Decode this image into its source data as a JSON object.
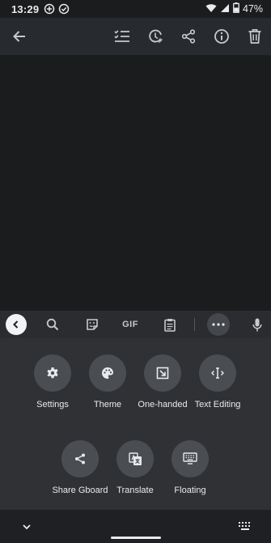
{
  "status_bar": {
    "time": "13:29",
    "battery_percent": "47%",
    "icons": [
      "add-circle-icon",
      "check-circle-icon",
      "wifi-icon",
      "signal-icon",
      "battery-icon"
    ]
  },
  "app_bar": {
    "icons": [
      "back-arrow-icon",
      "checklist-icon",
      "reminder-icon",
      "share-icon",
      "info-icon",
      "delete-icon"
    ]
  },
  "keyboard_toolbar": {
    "gif_label": "GIF",
    "icons": [
      "collapse-icon",
      "search-icon",
      "sticker-icon",
      "gif-icon",
      "clipboard-icon",
      "more-icon",
      "mic-icon"
    ]
  },
  "keyboard_options": [
    {
      "label": "Settings",
      "icon": "gear-icon"
    },
    {
      "label": "Theme",
      "icon": "palette-icon"
    },
    {
      "label": "One-handed",
      "icon": "one-handed-icon"
    },
    {
      "label": "Text Editing",
      "icon": "text-cursor-icon"
    },
    {
      "label": "Share Gboard",
      "icon": "share-icon"
    },
    {
      "label": "Translate",
      "icon": "translate-icon"
    },
    {
      "label": "Floating",
      "icon": "keyboard-icon"
    }
  ],
  "colors": {
    "background": "#1b1c1e",
    "app_bar": "#272a2e",
    "keyboard_panel": "#2f3134",
    "option_circle": "#4a4d51",
    "text": "#e8eaed"
  }
}
